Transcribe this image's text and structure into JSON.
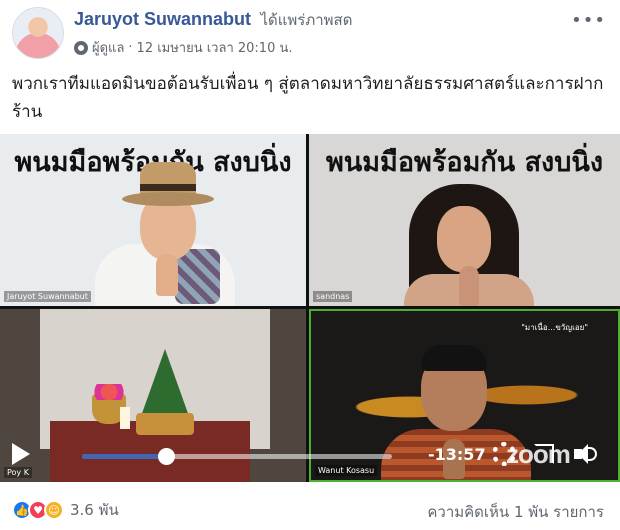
{
  "post": {
    "author": "Jaruyot Suwannabut",
    "action": "ได้แพร่ภาพสด",
    "role": "ผู้ดูแล",
    "separator": "·",
    "timestamp": "12 เมษายน เวลา 20:10 น.",
    "more_icon": "•••",
    "caption": "พวกเราทีมแอดมินขอต้อนรับเพื่อน ๆ สู่ตลาดมหาวิทยาลัยธรรมศาสตร์และการฝากร้าน"
  },
  "video": {
    "tiles": [
      {
        "banner": "พนมมือพร้อมกัน สงบนิ่ง",
        "label": "Jaruyot Suwannabut"
      },
      {
        "banner": "พนมมือพร้อมกัน สงบนิ่ง",
        "label": "sandnas"
      },
      {
        "label": "Poy K"
      },
      {
        "label": "Wanut Kosasu",
        "caption": "\"มาเนื่อ...ขวัญเอย\"",
        "watermark": "zoom"
      }
    ],
    "player": {
      "progress_fraction": 0.27,
      "time_remaining": "-13:57",
      "accent_color": "#4267b2"
    }
  },
  "footer": {
    "reaction_icons": [
      "like-icon",
      "love-icon",
      "haha-icon"
    ],
    "reaction_count": "3.6 พัน",
    "comments": "ความคิดเห็น 1 พัน รายการ"
  }
}
